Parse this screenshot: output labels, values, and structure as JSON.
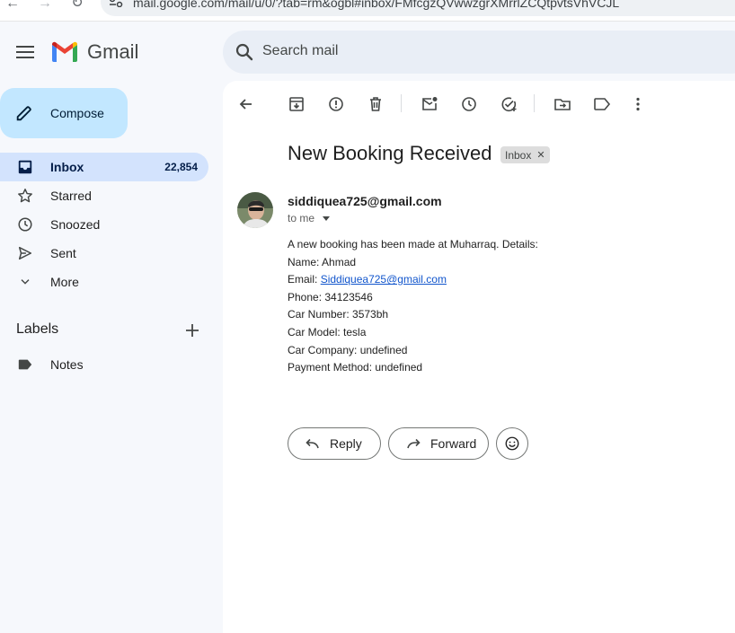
{
  "browser": {
    "url": "mail.google.com/mail/u/0/?tab=rm&ogbl#inbox/FMfcgzQVwwzgrXMrrlZCQtpvtsVhVCJL"
  },
  "header": {
    "brand": "Gmail",
    "search_placeholder": "Search mail"
  },
  "sidebar": {
    "compose_label": "Compose",
    "items": [
      {
        "label": "Inbox",
        "icon": "inbox-icon",
        "count": "22,854",
        "active": true
      },
      {
        "label": "Starred",
        "icon": "star-icon"
      },
      {
        "label": "Snoozed",
        "icon": "clock-icon"
      },
      {
        "label": "Sent",
        "icon": "send-icon"
      },
      {
        "label": "More",
        "icon": "chevron-down-icon"
      }
    ],
    "labels_heading": "Labels",
    "labels": [
      {
        "label": "Notes",
        "icon": "label-icon"
      }
    ]
  },
  "email": {
    "subject": "New Booking Received",
    "chip": "Inbox",
    "sender": "siddiquea725@gmail.com",
    "recipient": "to me",
    "body": {
      "intro": "A new booking has been made at Muharraq. Details:",
      "name": "Name: Ahmad",
      "email_prefix": "Email: ",
      "email_link": "Siddiquea725@gmail.com",
      "phone": "Phone: 34123546",
      "car_number": "Car Number: 3573bh",
      "car_model": "Car Model: tesla",
      "car_company": "Car Company: undefined",
      "payment": "Payment Method: undefined"
    }
  },
  "actions": {
    "reply_label": "Reply",
    "forward_label": "Forward"
  },
  "colors": {
    "accent": "#c2e7ff",
    "active_nav": "#d3e3fd",
    "link": "#1155cc",
    "search_bg": "#e9eef6"
  }
}
